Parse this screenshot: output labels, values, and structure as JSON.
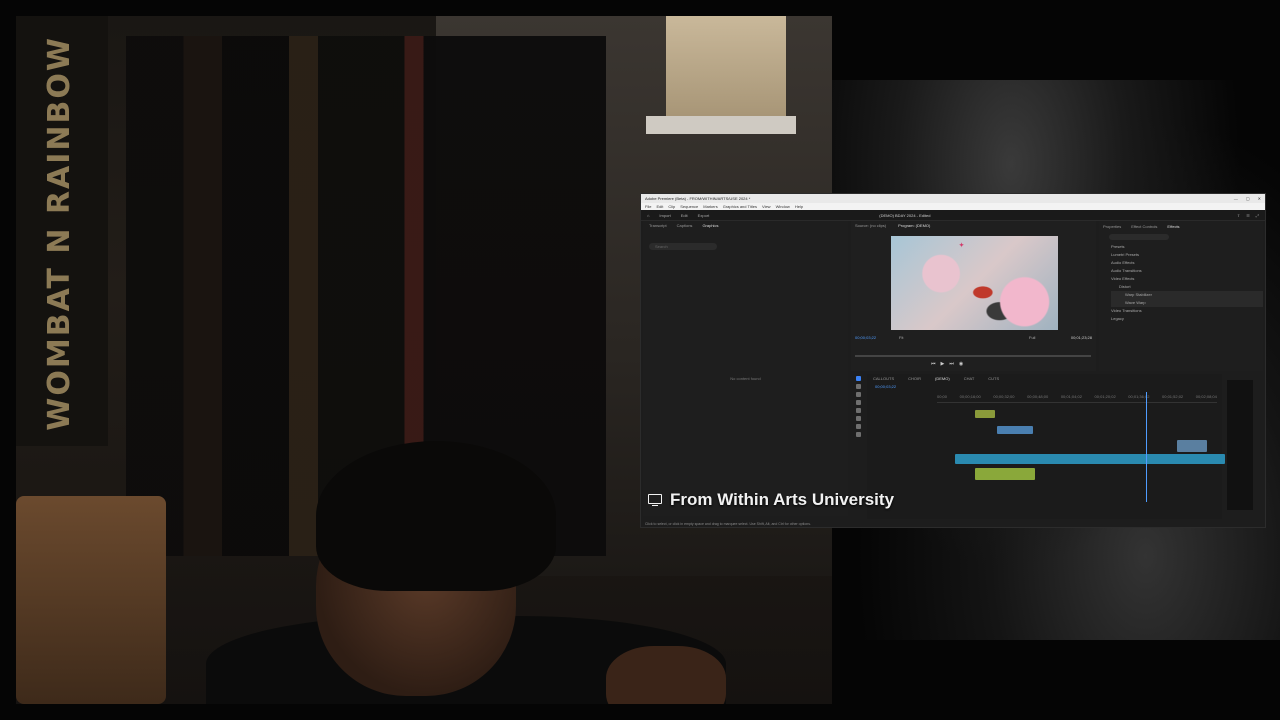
{
  "webcam": {
    "banner_text": "WOMBAT N RAINBOW"
  },
  "premiere": {
    "title": "Adobe Premiere (Beta) - FROM/WITHIN/ARTS/USE 2024 *",
    "window_controls": [
      "—",
      "▢",
      "✕"
    ],
    "menus": [
      "File",
      "Edit",
      "Clip",
      "Sequence",
      "Markers",
      "Graphics and Titles",
      "View",
      "Window",
      "Help"
    ],
    "header_tabs": [
      "Import",
      "Edit",
      "Export"
    ],
    "header_center": "(DEMO) BDAY 2024 - Edited",
    "left_tabs": [
      "Transcript",
      "Captions",
      "Graphics"
    ],
    "left_search_placeholder": "Search",
    "left_empty": "No content found",
    "monitor_tabs": [
      "Source: (no clips)",
      "Program: (DEMO)"
    ],
    "program_timecode_left": "00;00;03;22",
    "program_timecode_right": "00;01;23;28",
    "fit_label": "Fit",
    "full_label": "Full",
    "effects_tabs": [
      "Properties",
      "Effect Controls",
      "Effects"
    ],
    "effects_list": [
      {
        "label": "Presets",
        "level": 0
      },
      {
        "label": "Lumetri Presets",
        "level": 0
      },
      {
        "label": "Audio Effects",
        "level": 0
      },
      {
        "label": "Audio Transitions",
        "level": 0
      },
      {
        "label": "Video Effects",
        "level": 0
      },
      {
        "label": "Distort",
        "level": 1
      },
      {
        "label": "Warp Stabilizer",
        "level": 2
      },
      {
        "label": "Wave Warp",
        "level": 2
      },
      {
        "label": "Video Transitions",
        "level": 0
      },
      {
        "label": "Legacy",
        "level": 0
      }
    ],
    "sequence_tabs": [
      "CALLOUTS",
      "CHOIR",
      "(DEMO)",
      "CHAT",
      "CUTS"
    ],
    "sequence_timecode": "00;00;03;22",
    "ruler_ticks": [
      "00;00",
      "00;00;16;00",
      "00;00;32;00",
      "00;00;48;00",
      "00;01;04;02",
      "00;01;20;02",
      "00;01;36;02",
      "00;01;52;02",
      "00;02;08;04"
    ],
    "status_text": "Click to select, or click in empty space and drag to marquee select. Use Shift, Alt, and Ctrl for other options."
  },
  "caption": {
    "text": "From Within Arts University",
    "icon": "monitor-icon"
  }
}
